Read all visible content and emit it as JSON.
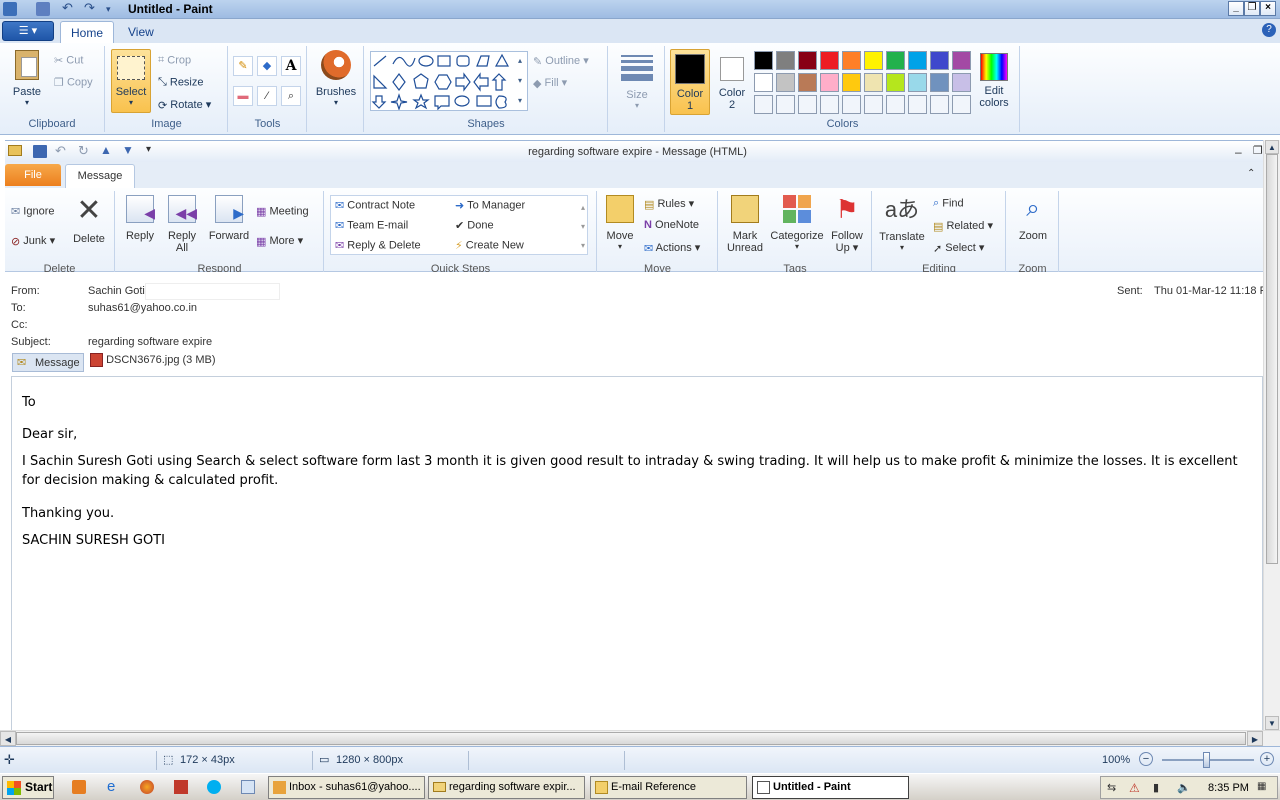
{
  "paint": {
    "window_title": "Untitled - Paint",
    "tabs": [
      "Home",
      "View"
    ],
    "clipboard": {
      "paste": "Paste",
      "cut": "Cut",
      "copy": "Copy",
      "group": "Clipboard"
    },
    "image": {
      "select": "Select",
      "crop": "Crop",
      "resize": "Resize",
      "rotate": "Rotate",
      "group": "Image"
    },
    "tools": {
      "group": "Tools"
    },
    "brushes": {
      "label": "Brushes"
    },
    "shapes": {
      "outline": "Outline",
      "fill": "Fill",
      "group": "Shapes"
    },
    "size": {
      "label": "Size"
    },
    "colors": {
      "color1": "Color 1",
      "color1_line1": "Color",
      "color1_line2": "1",
      "color2_line1": "Color",
      "color2_line2": "2",
      "edit_line1": "Edit",
      "edit_line2": "colors",
      "group": "Colors",
      "palette_row1": [
        "#000000",
        "#7f7f7f",
        "#880015",
        "#ed1c24",
        "#ff7f27",
        "#fff200",
        "#22b14c",
        "#00a2e8",
        "#3f48cc",
        "#a349a4"
      ],
      "palette_row2": [
        "#ffffff",
        "#c3c3c3",
        "#b97a57",
        "#ffaec9",
        "#ffc90e",
        "#efe4b0",
        "#b5e61d",
        "#99d9ea",
        "#7092be",
        "#c8bfe7"
      ]
    },
    "status": {
      "selection_size": "172 × 43px",
      "canvas_size": "1280 × 800px",
      "zoom": "100%"
    }
  },
  "outlook": {
    "window_title": "regarding software expire  -  Message (HTML)",
    "tabs": {
      "file": "File",
      "message": "Message"
    },
    "delete_group": {
      "ignore": "Ignore",
      "junk": "Junk",
      "delete": "Delete",
      "group": "Delete"
    },
    "respond_group": {
      "reply": "Reply",
      "reply_all_1": "Reply",
      "reply_all_2": "All",
      "forward": "Forward",
      "meeting": "Meeting",
      "more": "More",
      "group": "Respond"
    },
    "quick_steps": {
      "items": [
        "Contract Note",
        "Team E-mail",
        "Reply & Delete",
        "To Manager",
        "Done",
        "Create New"
      ],
      "group": "Quick Steps"
    },
    "move_group": {
      "move": "Move",
      "rules": "Rules",
      "onenote": "OneNote",
      "actions": "Actions",
      "group": "Move"
    },
    "tags_group": {
      "mark_1": "Mark",
      "mark_2": "Unread",
      "categorize": "Categorize",
      "follow_1": "Follow",
      "follow_2": "Up",
      "group": "Tags"
    },
    "editing_group": {
      "translate": "Translate",
      "find": "Find",
      "related": "Related",
      "select": "Select",
      "group": "Editing"
    },
    "zoom_group": {
      "zoom": "Zoom",
      "group": "Zoom"
    }
  },
  "message": {
    "from_label": "From:",
    "from": "Sachin Goti",
    "to_label": "To:",
    "to": "suhas61@yahoo.co.in",
    "cc_label": "Cc:",
    "subject_label": "Subject:",
    "subject": "regarding software expire",
    "sent_label": "Sent:",
    "sent": "Thu 01-Mar-12 11:18 P",
    "tab_message": "Message",
    "attachment": "DSCN3676.jpg (3 MB)",
    "body": {
      "line1": "To",
      "line2": "Dear sir,",
      "line3": "I  Sachin Suresh Goti using Search &  select software form last 3 month it is given good result to intraday & swing trading. It will help us to make profit & minimize the losses. It is excellent for decision  making & calculated profit.",
      "line4": "Thanking you.",
      "line5": "SACHIN SURESH GOTI"
    }
  },
  "taskbar": {
    "start": "Start",
    "items": [
      "Inbox - suhas61@yahoo....",
      "regarding software expir...",
      "E-mail Reference",
      "Untitled - Paint"
    ],
    "clock": "8:35 PM"
  }
}
